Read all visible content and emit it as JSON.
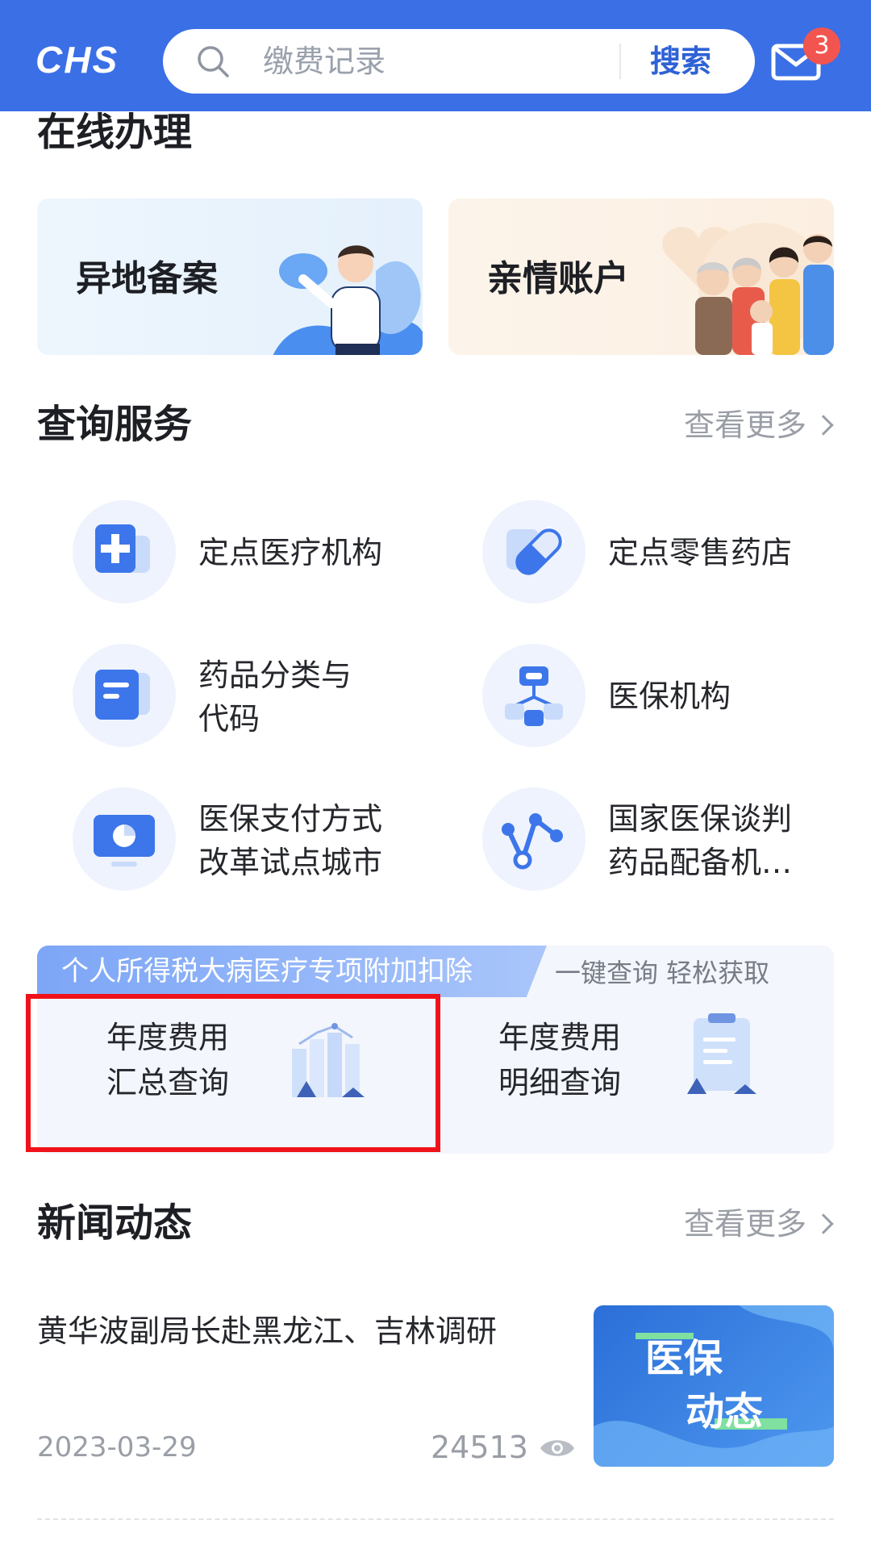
{
  "header": {
    "logo_text": "CHS",
    "search_placeholder": "缴费记录",
    "search_button": "搜索",
    "mail_badge": "3"
  },
  "online": {
    "title": "在线办理",
    "cards": [
      {
        "label": "异地备案"
      },
      {
        "label": "亲情账户"
      }
    ]
  },
  "query": {
    "title": "查询服务",
    "more": "查看更多",
    "items": [
      {
        "line1": "定点医疗机构",
        "line2": ""
      },
      {
        "line1": "定点零售药店",
        "line2": ""
      },
      {
        "line1": "药品分类与",
        "line2": "代码"
      },
      {
        "line1": "医保机构",
        "line2": ""
      },
      {
        "line1": "医保支付方式",
        "line2": "改革试点城市"
      },
      {
        "line1": "国家医保谈判",
        "line2": "药品配备机…"
      }
    ]
  },
  "tax": {
    "tag": "个人所得税大病医疗专项附加扣除",
    "subtitle": "一键查询  轻松获取",
    "items": [
      {
        "line1": "年度费用",
        "line2": "汇总查询"
      },
      {
        "line1": "年度费用",
        "line2": "明细查询"
      }
    ]
  },
  "news": {
    "title": "新闻动态",
    "more": "查看更多",
    "items": [
      {
        "headline": "黄华波副局长赴黑龙江、吉林调研",
        "date": "2023-03-29",
        "views": "24513",
        "thumb_line1": "医保",
        "thumb_line2": "动态"
      }
    ]
  },
  "colors": {
    "brand_blue": "#3a6fe6",
    "highlight_red": "#f0121b",
    "badge_red": "#f2554f"
  }
}
